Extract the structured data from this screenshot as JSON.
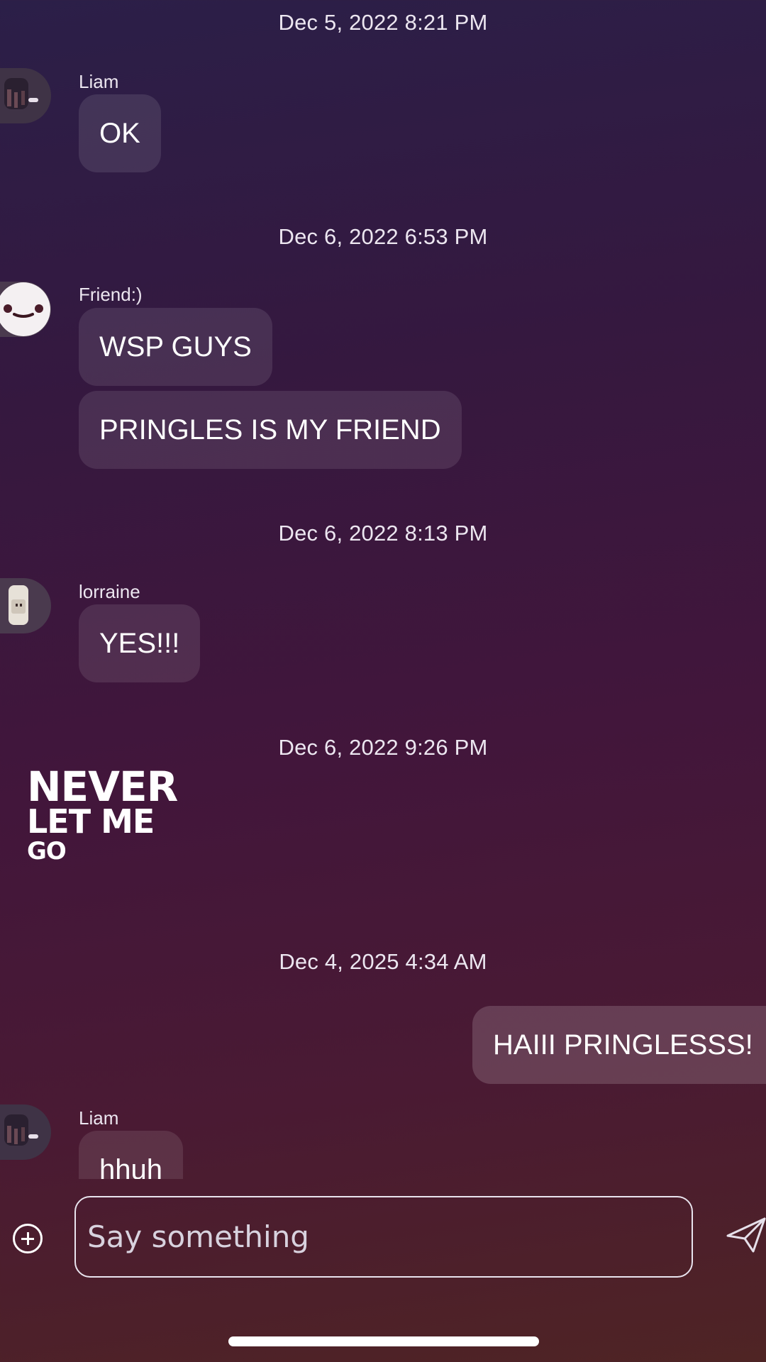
{
  "messages": [
    {
      "timestamp": "Dec 5, 2022 8:21 PM",
      "sender": "Liam",
      "texts": [
        "OK"
      ]
    },
    {
      "timestamp": "Dec 6, 2022 6:53 PM",
      "sender": "Friend:)",
      "texts": [
        "WSP GUYS",
        "PRINGLES IS MY FRIEND"
      ]
    },
    {
      "timestamp": "Dec 6, 2022 8:13 PM",
      "sender": "lorraine",
      "texts": [
        "YES!!!"
      ]
    },
    {
      "timestamp": "Dec 6, 2022 9:26 PM",
      "sticker": [
        "NEVER",
        "LET ME",
        "GO"
      ]
    },
    {
      "timestamp": "Dec 4, 2025 4:34 AM",
      "mine_text": "HAIII PRINGLESSS!"
    },
    {
      "sender": "Liam",
      "texts": [
        "hhuh"
      ]
    }
  ],
  "composer": {
    "placeholder": "Say something"
  },
  "icons": {
    "add": "plus-circle-icon",
    "send": "paper-plane-icon"
  },
  "colors": {
    "bubble": "rgba(255,255,255,0.10)",
    "background_top": "#2b1f48",
    "background_bottom": "#4f2424"
  }
}
